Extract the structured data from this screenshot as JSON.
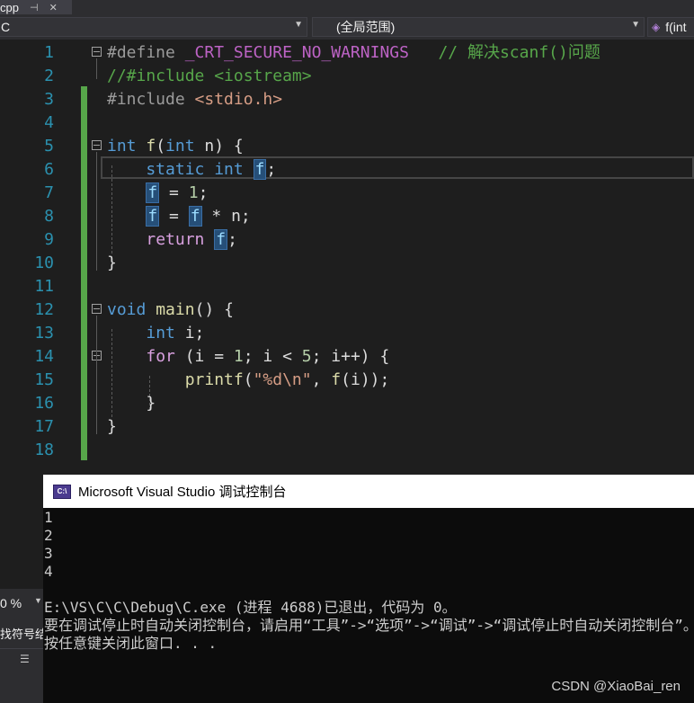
{
  "tab": {
    "label": "cpp",
    "pin": "⊣",
    "close": "✕"
  },
  "navbar": {
    "project": "C",
    "scope": "(全局范围)",
    "member": "f(int"
  },
  "editor": {
    "line_numbers": [
      "1",
      "2",
      "3",
      "4",
      "5",
      "6",
      "7",
      "8",
      "9",
      "10",
      "11",
      "12",
      "13",
      "14",
      "15",
      "16",
      "17",
      "18"
    ],
    "lines": [
      [
        {
          "t": "#define ",
          "c": "pp"
        },
        {
          "t": "_CRT_SECURE_NO_WARNINGS",
          "c": "macro"
        },
        {
          "t": "   // 解决scanf()问题",
          "c": "cm"
        }
      ],
      [
        {
          "t": "//#include <iostream>",
          "c": "cm"
        }
      ],
      [
        {
          "t": "#include ",
          "c": "pp"
        },
        {
          "t": "<stdio.h>",
          "c": "str"
        }
      ],
      [],
      [
        {
          "t": "int",
          "c": "kw"
        },
        {
          "t": " ",
          "c": ""
        },
        {
          "t": "f",
          "c": "fn"
        },
        {
          "t": "(",
          "c": ""
        },
        {
          "t": "int",
          "c": "kw"
        },
        {
          "t": " n) {",
          "c": ""
        }
      ],
      [
        {
          "t": "    static int ",
          "c": "kw"
        },
        {
          "t": "f",
          "c": "hl"
        },
        {
          "t": ";",
          "c": ""
        }
      ],
      [
        {
          "t": "    ",
          "c": ""
        },
        {
          "t": "f",
          "c": "hl"
        },
        {
          "t": " = ",
          "c": ""
        },
        {
          "t": "1",
          "c": "num"
        },
        {
          "t": ";",
          "c": ""
        }
      ],
      [
        {
          "t": "    ",
          "c": ""
        },
        {
          "t": "f",
          "c": "hl"
        },
        {
          "t": " = ",
          "c": ""
        },
        {
          "t": "f",
          "c": "hl"
        },
        {
          "t": " * n;",
          "c": ""
        }
      ],
      [
        {
          "t": "    ",
          "c": ""
        },
        {
          "t": "return",
          "c": "ctl"
        },
        {
          "t": " ",
          "c": ""
        },
        {
          "t": "f",
          "c": "hl"
        },
        {
          "t": ";",
          "c": ""
        }
      ],
      [
        {
          "t": "}",
          "c": ""
        }
      ],
      [],
      [
        {
          "t": "void",
          "c": "kw"
        },
        {
          "t": " ",
          "c": ""
        },
        {
          "t": "main",
          "c": "fn"
        },
        {
          "t": "() {",
          "c": ""
        }
      ],
      [
        {
          "t": "    ",
          "c": ""
        },
        {
          "t": "int",
          "c": "kw"
        },
        {
          "t": " i;",
          "c": ""
        }
      ],
      [
        {
          "t": "    ",
          "c": ""
        },
        {
          "t": "for",
          "c": "ctl"
        },
        {
          "t": " (i = ",
          "c": ""
        },
        {
          "t": "1",
          "c": "num"
        },
        {
          "t": "; i < ",
          "c": ""
        },
        {
          "t": "5",
          "c": "num"
        },
        {
          "t": "; i++) {",
          "c": ""
        }
      ],
      [
        {
          "t": "        ",
          "c": ""
        },
        {
          "t": "printf",
          "c": "fn"
        },
        {
          "t": "(",
          "c": ""
        },
        {
          "t": "\"%d\\n\"",
          "c": "str"
        },
        {
          "t": ", ",
          "c": ""
        },
        {
          "t": "f",
          "c": "fn"
        },
        {
          "t": "(i));",
          "c": ""
        }
      ],
      [
        {
          "t": "    }",
          "c": ""
        }
      ],
      [
        {
          "t": "}",
          "c": ""
        }
      ],
      []
    ]
  },
  "console": {
    "title": "Microsoft Visual Studio 调试控制台",
    "icon_text": "C:\\",
    "output": [
      "1",
      "2",
      "3",
      "4",
      "",
      "E:\\VS\\C\\C\\Debug\\C.exe (进程 4688)已退出，代码为 0。",
      "要在调试停止时自动关闭控制台，请启用“工具”->“选项”->“调试”->“调试停止时自动关闭控制台”。",
      "按任意键关闭此窗口. . ."
    ],
    "watermark": "CSDN @XiaoBai_ren"
  },
  "left_panel": {
    "zoom": "0 %",
    "label": "找符号结果",
    "toolbar_icon": "list-icon"
  }
}
